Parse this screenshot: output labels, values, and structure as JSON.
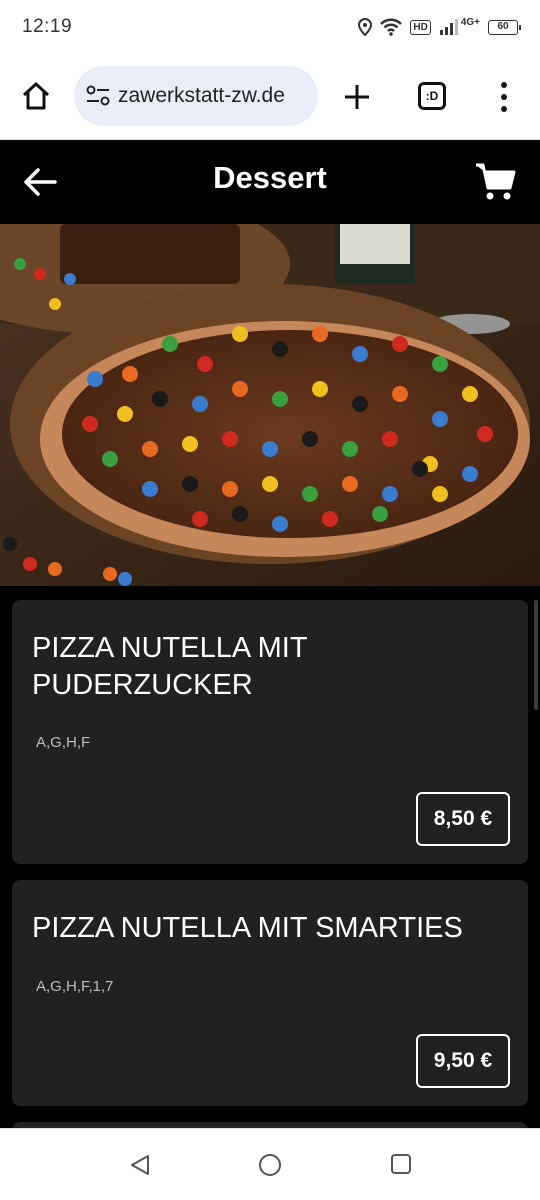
{
  "status_bar": {
    "time": "12:19",
    "hd_badge": "HD",
    "network": "4G+",
    "battery": "60"
  },
  "browser": {
    "url": "zawerkstatt-zw.de",
    "tabs_label": ":D",
    "icons": [
      "home-icon",
      "site-settings-icon",
      "plus-icon",
      "tabs-icon",
      "more-icon"
    ]
  },
  "header": {
    "title": "Dessert",
    "icons": [
      "back-arrow-icon",
      "cart-icon"
    ]
  },
  "menu_items": [
    {
      "name": "PIZZA NUTELLA MIT PUDERZUCKER",
      "allergens": "A,G,H,F",
      "price": "8,50 €"
    },
    {
      "name": "PIZZA NUTELLA MIT SMARTIES",
      "allergens": "A,G,H,F,1,7",
      "price": "9,50 €"
    }
  ],
  "colors": {
    "header_bg": "#000000",
    "card_bg": "#212121",
    "text": "#ffffff",
    "url_pill": "#e8edf7"
  }
}
